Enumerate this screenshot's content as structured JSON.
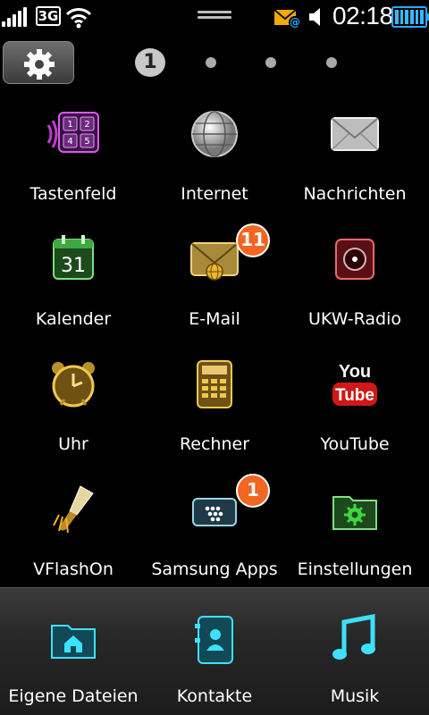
{
  "status_bar": {
    "network_type": "3G",
    "time": "02:18",
    "signal_icon": "signal-bars-icon",
    "wifi_icon": "wifi-icon",
    "mail_alert_icon": "mail-notification-icon",
    "speaker_icon": "speaker-icon",
    "battery_icon": "battery-icon"
  },
  "toolbar": {
    "settings_icon": "gear-icon",
    "current_page": "1",
    "page_count": 4
  },
  "apps": [
    {
      "label": "Tastenfeld",
      "icon": "keypad-icon",
      "badge": null
    },
    {
      "label": "Internet",
      "icon": "globe-icon",
      "badge": null
    },
    {
      "label": "Nachrichten",
      "icon": "envelope-icon",
      "badge": null
    },
    {
      "label": "Kalender",
      "icon": "calendar-icon",
      "badge": null,
      "icon_text": "31"
    },
    {
      "label": "E-Mail",
      "icon": "email-globe-icon",
      "badge": "11"
    },
    {
      "label": "UKW-Radio",
      "icon": "radio-icon",
      "badge": null
    },
    {
      "label": "Uhr",
      "icon": "alarm-clock-icon",
      "badge": null
    },
    {
      "label": "Rechner",
      "icon": "calculator-icon",
      "badge": null
    },
    {
      "label": "YouTube",
      "icon": "youtube-icon",
      "badge": null,
      "icon_text_top": "You",
      "icon_text_bottom": "Tube"
    },
    {
      "label": "VFlashOn",
      "icon": "flashlight-icon",
      "badge": null
    },
    {
      "label": "Samsung Apps",
      "icon": "samsung-apps-icon",
      "badge": "1"
    },
    {
      "label": "Einstellungen",
      "icon": "settings-folder-icon",
      "badge": null
    }
  ],
  "dock": [
    {
      "label": "Eigene Dateien",
      "icon": "home-folder-icon"
    },
    {
      "label": "Kontakte",
      "icon": "contacts-icon"
    },
    {
      "label": "Musik",
      "icon": "music-note-icon"
    }
  ],
  "colors": {
    "badge": "#f26522",
    "battery": "#37b8ff",
    "dock_accent": "#3fe0ff"
  }
}
